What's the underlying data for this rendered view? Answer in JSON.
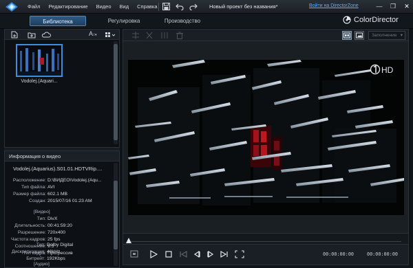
{
  "titlebar": {
    "menu": [
      "Файл",
      "Редактирование",
      "Видео",
      "Вид",
      "Справка"
    ],
    "doc_title": "Новый проект без названия*",
    "login_link": "Войти на DirectorZone",
    "icons": [
      "cyberlink-logo",
      "save-icon",
      "undo-icon",
      "redo-icon",
      "minimize-icon",
      "restore-icon",
      "close-icon"
    ]
  },
  "tabs": [
    "Библиотека",
    "Регулировка",
    "Производство"
  ],
  "brand": "ColorDirector",
  "library": {
    "toolbar_icons": [
      "import-file-icon",
      "import-folder-icon",
      "cloud-icon",
      "sort-icon",
      "grid-view-icon"
    ],
    "font_label": "A",
    "items": [
      {
        "label": "Vodolej.(Aquari..."
      }
    ]
  },
  "video_info": {
    "header": "Информация о видео",
    "file_name": "Vodolej.(Aquarius).S01.01.HDTVRip....",
    "general": [
      {
        "k": "Расположение:",
        "v": "D:\\ВИДЕО\\Vodolej.(Aqu..."
      },
      {
        "k": "Тип файла:",
        "v": "AVI"
      },
      {
        "k": "Размер файла:",
        "v": "602.1 MB"
      },
      {
        "k": "Создан:",
        "v": "2015/07/16 01:23 AM"
      }
    ],
    "video_section": "[Видео]",
    "video": [
      {
        "k": "Тип:",
        "v": "DivX"
      },
      {
        "k": "Длительность:",
        "v": "00:41:59:20"
      },
      {
        "k": "Разрешение:",
        "v": "720x400"
      },
      {
        "k": "Частота кадров:",
        "v": "25 fps"
      },
      {
        "k": "Соотношение:",
        "v": "9:5"
      },
      {
        "k": "Тип кадра:",
        "v": "Прогрессив"
      }
    ],
    "audio_section": "[Аудио]",
    "audio": [
      {
        "k": "Тип:",
        "v": "Dolby Digital"
      },
      {
        "k": "Дискретизация:",
        "v": "48kHz"
      },
      {
        "k": "Битрейт:",
        "v": "192Kbps"
      }
    ]
  },
  "preview": {
    "fill_mode": "Заполнение",
    "channel_logo_text": "HD",
    "timecode_current": "00:00:00:00",
    "timecode_total": "00:00:00:00",
    "playback_icons": [
      "snapshot-icon",
      "play-icon",
      "stop-icon",
      "prev-frame-icon",
      "previous-icon",
      "next-icon",
      "next-frame-icon",
      "fullscreen-icon"
    ]
  },
  "colors": {
    "accent": "#3d8fdb",
    "link": "#5fb0ff",
    "panel": "#1a1f25",
    "background": "#0f1419"
  }
}
